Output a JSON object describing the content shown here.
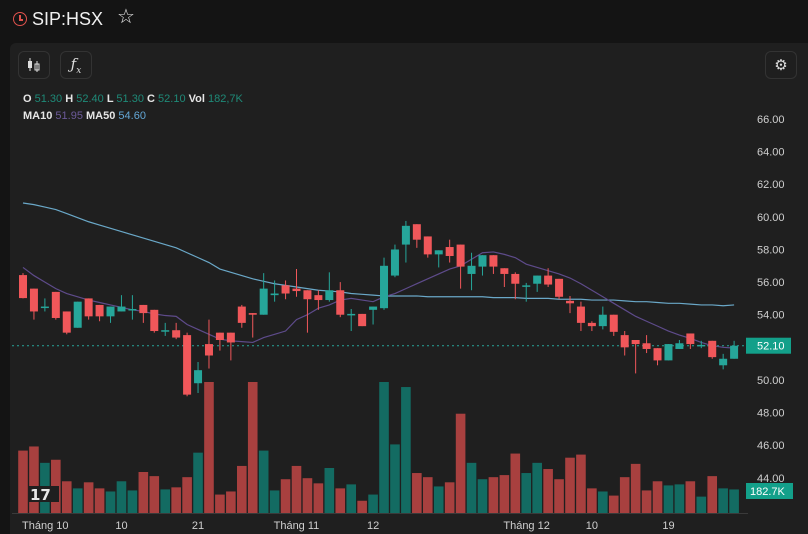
{
  "header": {
    "symbol": "SIP:HSX"
  },
  "legend": {
    "o_label": "O",
    "o": "51.30",
    "h_label": "H",
    "h": "52.40",
    "l_label": "L",
    "l": "51.30",
    "c_label": "C",
    "c": "52.10",
    "vol_label": "Vol",
    "vol": "182,7K",
    "ma10_label": "MA10",
    "ma10": "51.95",
    "ma50_label": "MA50",
    "ma50": "54.60"
  },
  "colors": {
    "up": "#26a69a",
    "down": "#f0575a",
    "vol_up": "#136b62",
    "vol_down": "#a8403f",
    "ma10": "#5e4b8b",
    "ma50": "#6aa8c8",
    "bg": "#1f1f1f"
  },
  "price_axis": {
    "labels": [
      "66.00",
      "64.00",
      "62.00",
      "60.00",
      "58.00",
      "56.00",
      "54.00",
      "52.00",
      "50.00",
      "48.00",
      "46.00",
      "44.00"
    ],
    "last_price": "52.10",
    "last_volume": "182.7K"
  },
  "chart_data": {
    "type": "candlestick",
    "ylim": [
      44,
      66
    ],
    "ohlc": [
      [
        56.43,
        56.55,
        55.0,
        55.02
      ],
      [
        55.6,
        55.6,
        53.7,
        54.2
      ],
      [
        54.45,
        55.0,
        54.2,
        54.5
      ],
      [
        55.4,
        55.4,
        53.7,
        53.8
      ],
      [
        54.2,
        54.2,
        52.8,
        52.9
      ],
      [
        53.2,
        54.8,
        53.2,
        54.8
      ],
      [
        55.0,
        55.0,
        53.7,
        53.9
      ],
      [
        54.6,
        54.6,
        53.6,
        53.9
      ],
      [
        53.9,
        54.5,
        53.5,
        54.5
      ],
      [
        54.2,
        55.2,
        54.2,
        54.5
      ],
      [
        54.3,
        55.2,
        53.7,
        54.35
      ],
      [
        54.6,
        54.6,
        53.5,
        54.1
      ],
      [
        54.3,
        54.3,
        52.9,
        53.0
      ],
      [
        53.0,
        53.5,
        52.7,
        53.05
      ],
      [
        53.05,
        53.5,
        52.5,
        52.6
      ],
      [
        52.75,
        52.9,
        49.0,
        49.1
      ],
      [
        49.8,
        51.1,
        49.2,
        50.6
      ],
      [
        52.2,
        53.7,
        50.7,
        51.5
      ],
      [
        52.9,
        52.9,
        51.8,
        52.45
      ],
      [
        52.9,
        52.9,
        51.2,
        52.3
      ],
      [
        54.5,
        54.6,
        53.2,
        53.5
      ],
      [
        54.1,
        54.1,
        52.6,
        54.0
      ],
      [
        54.0,
        56.55,
        54.0,
        55.6
      ],
      [
        55.2,
        56.1,
        54.8,
        55.3
      ],
      [
        55.8,
        56.1,
        54.95,
        55.3
      ],
      [
        55.6,
        56.8,
        55.1,
        55.45
      ],
      [
        55.5,
        55.5,
        52.9,
        54.95
      ],
      [
        55.2,
        55.5,
        54.3,
        54.9
      ],
      [
        54.9,
        56.6,
        54.8,
        55.5
      ],
      [
        55.5,
        56.0,
        53.85,
        54.0
      ],
      [
        54.0,
        54.35,
        53.0,
        54.05
      ],
      [
        54.05,
        54.05,
        53.3,
        53.3
      ],
      [
        54.3,
        54.5,
        53.4,
        54.5
      ],
      [
        54.4,
        57.5,
        54.3,
        57.0
      ],
      [
        56.4,
        58.3,
        56.3,
        58.0
      ],
      [
        58.3,
        59.75,
        57.2,
        59.45
      ],
      [
        59.55,
        59.55,
        58.1,
        58.6
      ],
      [
        58.8,
        58.8,
        57.5,
        57.7
      ],
      [
        57.7,
        57.95,
        56.9,
        57.95
      ],
      [
        58.15,
        58.6,
        57.2,
        57.6
      ],
      [
        58.3,
        58.3,
        55.6,
        56.95
      ],
      [
        56.5,
        57.8,
        55.5,
        57.0
      ],
      [
        56.95,
        57.65,
        56.4,
        57.65
      ],
      [
        57.65,
        57.65,
        56.5,
        56.95
      ],
      [
        56.85,
        56.85,
        55.7,
        56.5
      ],
      [
        56.5,
        56.6,
        54.95,
        55.9
      ],
      [
        55.75,
        55.95,
        54.8,
        55.8
      ],
      [
        55.9,
        56.4,
        55.4,
        56.4
      ],
      [
        56.4,
        56.85,
        55.7,
        55.85
      ],
      [
        56.2,
        56.2,
        54.95,
        55.1
      ],
      [
        54.85,
        55.15,
        54.1,
        54.7
      ],
      [
        54.5,
        54.8,
        53.0,
        53.5
      ],
      [
        53.5,
        53.6,
        53.0,
        53.3
      ],
      [
        53.3,
        54.5,
        53.1,
        54.0
      ],
      [
        54.0,
        54.0,
        52.7,
        52.95
      ],
      [
        52.75,
        53.0,
        51.5,
        52.0
      ],
      [
        52.45,
        52.45,
        50.4,
        52.2
      ],
      [
        52.25,
        52.75,
        51.65,
        51.9
      ],
      [
        51.95,
        51.95,
        50.9,
        51.2
      ],
      [
        51.2,
        52.2,
        51.2,
        52.2
      ],
      [
        51.9,
        52.45,
        51.9,
        52.25
      ],
      [
        52.85,
        52.85,
        51.9,
        52.2
      ],
      [
        52.1,
        52.4,
        51.95,
        52.15
      ],
      [
        52.4,
        52.4,
        51.3,
        51.4
      ],
      [
        50.9,
        51.6,
        50.65,
        51.3
      ],
      [
        51.3,
        52.4,
        51.3,
        52.1
      ]
    ],
    "volume_k": [
      484,
      516,
      389,
      413,
      246,
      191,
      238,
      191,
      167,
      246,
      175,
      318,
      286,
      183,
      199,
      278,
      468,
      1016,
      143,
      167,
      365,
      1016,
      484,
      175,
      262,
      365,
      270,
      230,
      349,
      191,
      222,
      95,
      143,
      1016,
      532,
      977,
      310,
      278,
      206,
      238,
      770,
      389,
      262,
      278,
      294,
      461,
      310,
      389,
      341,
      262,
      429,
      453,
      191,
      167,
      135,
      278,
      381,
      175,
      246,
      214,
      222,
      246,
      127,
      286,
      191,
      182.7
    ],
    "ma10": [
      56.9,
      56.4,
      56.0,
      55.6,
      55.3,
      55.1,
      54.9,
      54.75,
      54.6,
      54.45,
      54.3,
      54.2,
      54.05,
      53.95,
      53.9,
      53.4,
      53.1,
      52.8,
      52.5,
      52.4,
      52.35,
      52.3,
      52.6,
      52.8,
      53.0,
      53.7,
      54.0,
      54.4,
      54.6,
      54.9,
      55.0,
      54.9,
      54.8,
      55.1,
      55.3,
      55.6,
      55.9,
      56.2,
      56.5,
      56.8,
      57.0,
      57.4,
      57.8,
      57.85,
      57.7,
      57.5,
      57.1,
      56.9,
      56.7,
      56.5,
      56.25,
      55.9,
      55.5,
      55.1,
      54.7,
      54.3,
      53.9,
      53.6,
      53.3,
      53.0,
      52.75,
      52.55,
      52.3,
      52.1,
      52.0,
      51.95
    ],
    "ma50": [
      60.85,
      60.75,
      60.6,
      60.45,
      60.2,
      59.95,
      59.7,
      59.5,
      59.3,
      59.1,
      58.9,
      58.7,
      58.5,
      58.3,
      58.1,
      57.8,
      57.5,
      57.2,
      56.8,
      56.6,
      56.4,
      56.2,
      56.05,
      55.9,
      55.8,
      55.7,
      55.6,
      55.5,
      55.45,
      55.4,
      55.3,
      55.25,
      55.2,
      55.15,
      55.15,
      55.15,
      55.15,
      55.1,
      55.1,
      55.1,
      55.1,
      55.1,
      55.1,
      55.05,
      55.05,
      55.05,
      55.0,
      55.0,
      55.0,
      54.95,
      54.95,
      54.95,
      54.9,
      54.9,
      54.9,
      54.85,
      54.8,
      54.8,
      54.75,
      54.7,
      54.7,
      54.65,
      54.6,
      54.6,
      54.55,
      54.6
    ],
    "x_labels": [
      {
        "i": 0,
        "text": "Tháng 10"
      },
      {
        "i": 9,
        "text": "10"
      },
      {
        "i": 16,
        "text": "21"
      },
      {
        "i": 23,
        "text": "Tháng 11"
      },
      {
        "i": 32,
        "text": "12"
      },
      {
        "i": 44,
        "text": "Tháng 12"
      },
      {
        "i": 52,
        "text": "10"
      },
      {
        "i": 59,
        "text": "19"
      }
    ]
  }
}
